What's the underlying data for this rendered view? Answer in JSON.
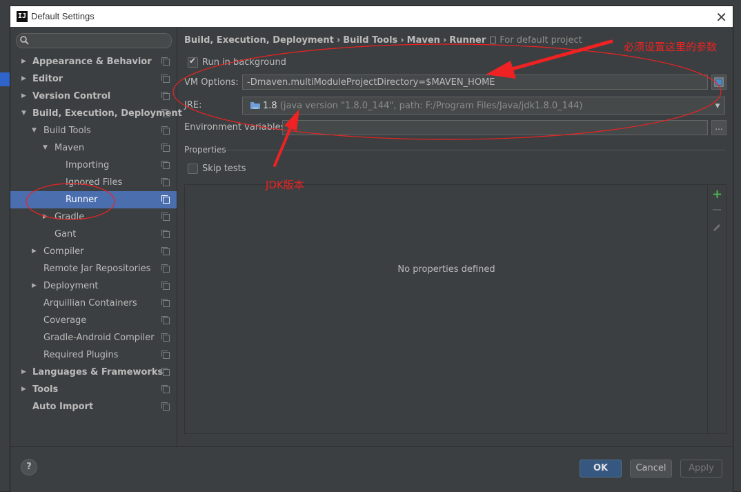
{
  "window": {
    "title": "Default Settings",
    "app_icon": "IJ"
  },
  "search": {
    "placeholder": ""
  },
  "sidebar": {
    "items": [
      {
        "label": "Appearance & Behavior",
        "bold": true,
        "arrow": "▶",
        "level": 0
      },
      {
        "label": "Editor",
        "bold": true,
        "arrow": "▶",
        "level": 0
      },
      {
        "label": "Version Control",
        "bold": true,
        "arrow": "▶",
        "level": 0
      },
      {
        "label": "Build, Execution, Deployment",
        "bold": true,
        "arrow": "▼",
        "level": 0
      },
      {
        "label": "Build Tools",
        "bold": false,
        "arrow": "▼",
        "level": 1
      },
      {
        "label": "Maven",
        "bold": false,
        "arrow": "▼",
        "level": 2
      },
      {
        "label": "Importing",
        "bold": false,
        "arrow": "",
        "level": 3
      },
      {
        "label": "Ignored Files",
        "bold": false,
        "arrow": "",
        "level": 3
      },
      {
        "label": "Runner",
        "bold": false,
        "arrow": "",
        "level": 3,
        "selected": true
      },
      {
        "label": "Gradle",
        "bold": false,
        "arrow": "▶",
        "level": 2
      },
      {
        "label": "Gant",
        "bold": false,
        "arrow": "",
        "level": 2
      },
      {
        "label": "Compiler",
        "bold": false,
        "arrow": "▶",
        "level": 1
      },
      {
        "label": "Remote Jar Repositories",
        "bold": false,
        "arrow": "",
        "level": 1
      },
      {
        "label": "Deployment",
        "bold": false,
        "arrow": "▶",
        "level": 1
      },
      {
        "label": "Arquillian Containers",
        "bold": false,
        "arrow": "",
        "level": 1
      },
      {
        "label": "Coverage",
        "bold": false,
        "arrow": "",
        "level": 1
      },
      {
        "label": "Gradle-Android Compiler",
        "bold": false,
        "arrow": "",
        "level": 1
      },
      {
        "label": "Required Plugins",
        "bold": false,
        "arrow": "",
        "level": 1
      },
      {
        "label": "Languages & Frameworks",
        "bold": true,
        "arrow": "▶",
        "level": 0
      },
      {
        "label": "Tools",
        "bold": true,
        "arrow": "▶",
        "level": 0
      },
      {
        "label": "Auto Import",
        "bold": true,
        "arrow": "",
        "level": 0
      }
    ]
  },
  "breadcrumb": {
    "parts": [
      "Build, Execution, Deployment",
      "Build Tools",
      "Maven",
      "Runner"
    ],
    "separator": "›",
    "scope": "For default project"
  },
  "runner": {
    "run_in_background_label": "Run in background",
    "run_in_background_checked": true,
    "vm_options_label": "VM Options:",
    "vm_options_value": "-Dmaven.multiModuleProjectDirectory=$MAVEN_HOME",
    "jre_label": "JRE:",
    "jre_version": "1.8",
    "jre_detail": "(java version \"1.8.0_144\", path: F:/Program Files/Java/jdk1.8.0_144)",
    "env_label": "Environment variables:",
    "env_value": "",
    "env_button": "...",
    "properties_title": "Properties",
    "skip_tests_label": "Skip tests",
    "skip_tests_checked": false,
    "no_properties": "No properties defined"
  },
  "buttons": {
    "ok": "OK",
    "cancel": "Cancel",
    "apply": "Apply",
    "help": "?"
  },
  "annotations": {
    "params_note": "必须设置这里的参数",
    "jdk_note": "JDK版本",
    "color": "#ee2222"
  },
  "colors": {
    "selection": "#4b6eaf",
    "panel": "#3c3f41",
    "ok_button": "#365880",
    "add_icon": "#4caf50"
  }
}
